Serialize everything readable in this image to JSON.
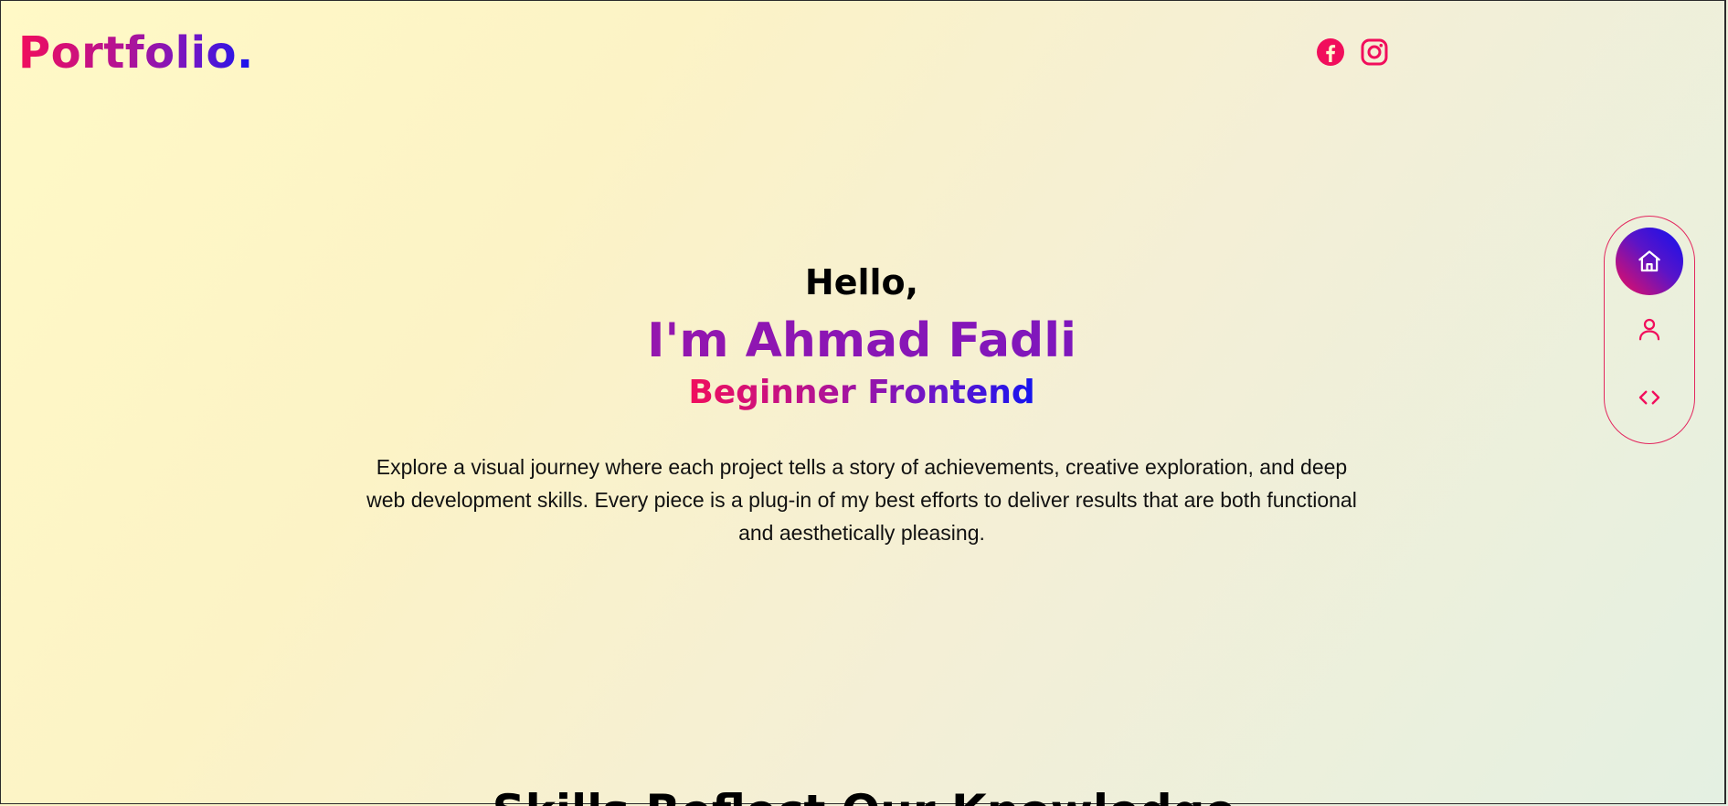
{
  "header": {
    "logo_text": "Portfolio.",
    "socials": [
      {
        "icon": "facebook-icon",
        "color": "#f10e5c"
      },
      {
        "icon": "instagram-icon",
        "color": "#f10e5c"
      }
    ]
  },
  "hero": {
    "greeting": "Hello,",
    "name": "I'm Ahmad Fadli",
    "role": "Beginner Frontend",
    "description": "Explore a visual journey where each project tells a story of achievements, creative exploration, and deep web development skills. Every piece is a plug-in of my best efforts to deliver results that are both functional and aesthetically pleasing."
  },
  "sidenav": {
    "items": [
      {
        "icon": "home-icon",
        "active": true
      },
      {
        "icon": "user-icon",
        "active": false
      },
      {
        "icon": "code-icon",
        "active": false
      }
    ]
  },
  "next_section": {
    "heading": "Skills Reflect Our Knowledge"
  },
  "colors": {
    "accent_pink": "#f10e5c",
    "accent_purple": "#8a16b5",
    "accent_blue": "#1414f0"
  }
}
